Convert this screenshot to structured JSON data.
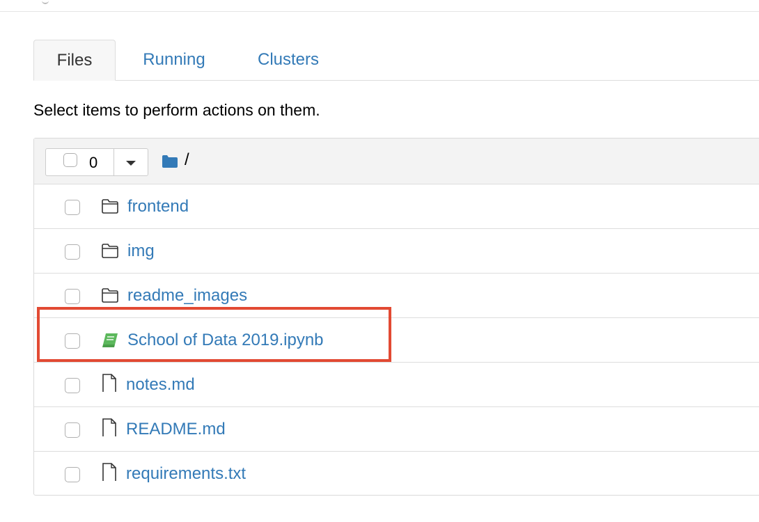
{
  "tabs": [
    {
      "label": "Files",
      "active": true
    },
    {
      "label": "Running",
      "active": false
    },
    {
      "label": "Clusters",
      "active": false
    }
  ],
  "instructions": "Select items to perform actions on them.",
  "header": {
    "selected_count": "0",
    "breadcrumb": "/",
    "folder_icon": "folder-solid-icon",
    "dropdown_icon": "caret-down-icon"
  },
  "rows": [
    {
      "name": "frontend",
      "type": "folder",
      "icon": "folder-outline-icon"
    },
    {
      "name": "img",
      "type": "folder",
      "icon": "folder-outline-icon"
    },
    {
      "name": "readme_images",
      "type": "folder",
      "icon": "folder-outline-icon"
    },
    {
      "name": "School of Data 2019.ipynb",
      "type": "notebook",
      "icon": "notebook-icon"
    },
    {
      "name": "notes.md",
      "type": "file",
      "icon": "file-icon"
    },
    {
      "name": "README.md",
      "type": "file",
      "icon": "file-icon"
    },
    {
      "name": "requirements.txt",
      "type": "file",
      "icon": "file-icon"
    }
  ],
  "colors": {
    "link": "#337ab7",
    "notebook_icon": "#5cb85c",
    "highlight": "#e24a33"
  }
}
